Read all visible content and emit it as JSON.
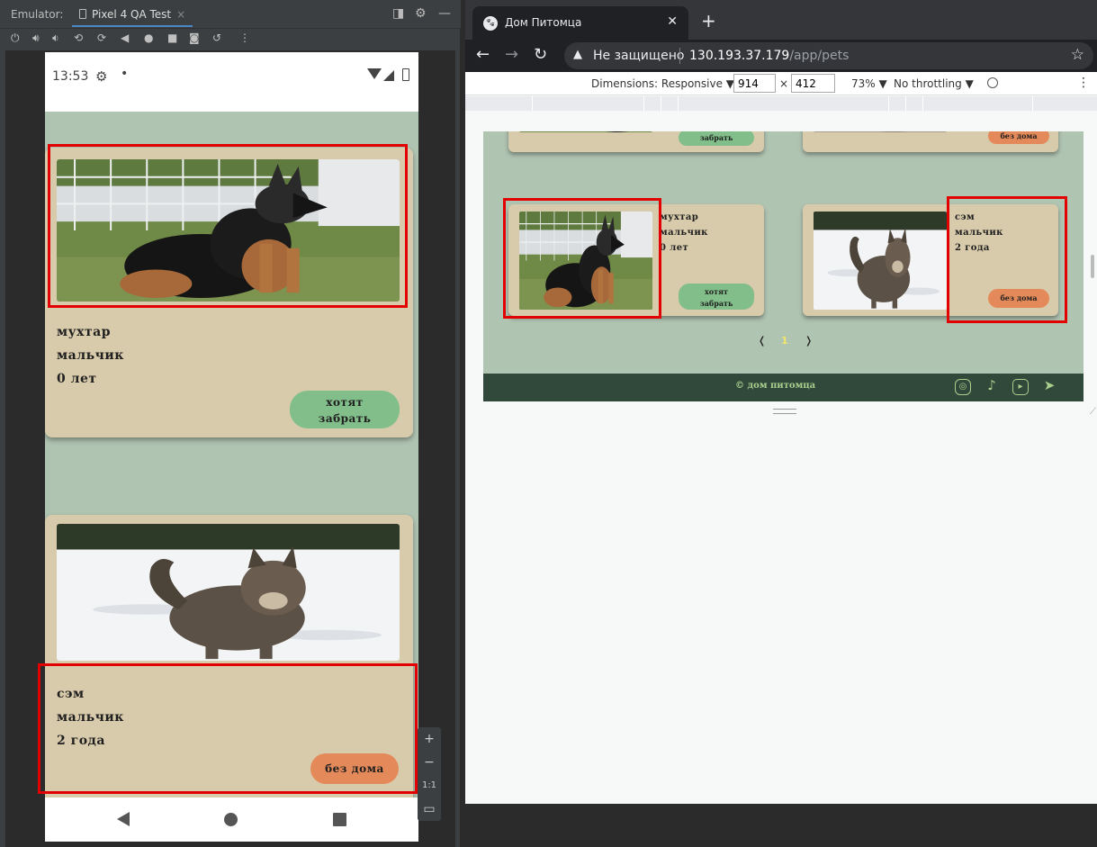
{
  "emulator": {
    "label": "Emulator:",
    "device_tab": "Pixel 4 QA Test",
    "tab_close": "×",
    "status": {
      "time": "13:53",
      "dot": "•"
    },
    "zoom": {
      "plus": "+",
      "minus": "−",
      "ratio": "1:1"
    }
  },
  "mobile_cards": [
    {
      "name": "мухтар",
      "gender": "мальчик",
      "age": "0 лет",
      "button": "хотят забрать",
      "button_color": "#82be8a"
    },
    {
      "name": "сэм",
      "gender": "мальчик",
      "age": "2 года",
      "button": "без дома",
      "button_color": "#e48a5a"
    }
  ],
  "browser": {
    "tab_title": "Дом Питомца",
    "tab_close": "✕",
    "new_tab": "+",
    "not_secure": "Не защищено",
    "url_host": "130.193.37.179",
    "url_path": "/app/pets",
    "devtools": {
      "dimensions_label": "Dimensions: Responsive ▼",
      "width": "914",
      "height": "412",
      "times": "×",
      "zoom": "73% ▼",
      "throttling": "No throttling ▼"
    }
  },
  "desktop_cards_top": [
    {
      "button": "забрать",
      "button_color": "#82be8a"
    },
    {
      "button": "без дома",
      "button_color": "#e48a5a"
    }
  ],
  "desktop_cards": [
    {
      "name": "мухтар",
      "gender": "мальчик",
      "age": "0 лет",
      "button": "хотят забрать",
      "button_color": "#82be8a"
    },
    {
      "name": "сэм",
      "gender": "мальчик",
      "age": "2 года",
      "button": "без дома",
      "button_color": "#e48a5a"
    }
  ],
  "pagination": {
    "prev": "❬",
    "current": "1",
    "next": "❭"
  },
  "footer": {
    "copyright": "© дом питомца"
  },
  "colors": {
    "page_bg": "#b0c4b2",
    "card_bg": "#d8cbab",
    "footer_bg": "#30493a",
    "highlight": "#e30000"
  }
}
